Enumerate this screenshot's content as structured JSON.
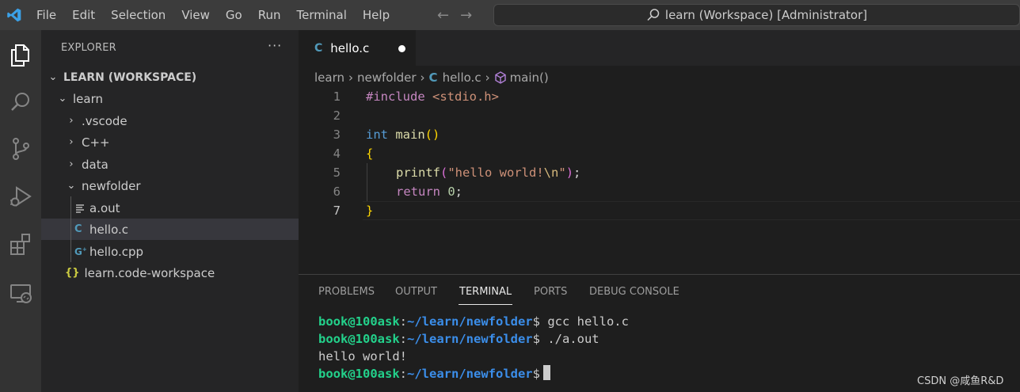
{
  "menu": [
    "File",
    "Edit",
    "Selection",
    "View",
    "Go",
    "Run",
    "Terminal",
    "Help"
  ],
  "search": {
    "text": "learn (Workspace) [Administrator]"
  },
  "sidebar": {
    "header": "EXPLORER",
    "more": "···",
    "tree": [
      {
        "label": "LEARN (WORKSPACE)",
        "icon": "chevron-down",
        "bold": true
      },
      {
        "label": "learn",
        "icon": "chevron-down"
      },
      {
        "label": ".vscode",
        "icon": "chevron-right"
      },
      {
        "label": "C++",
        "icon": "chevron-right"
      },
      {
        "label": "data",
        "icon": "chevron-right"
      },
      {
        "label": "newfolder",
        "icon": "chevron-down"
      },
      {
        "label": "a.out",
        "icon": "text-file-icon"
      },
      {
        "label": "hello.c",
        "icon": "c-file-icon",
        "selected": true
      },
      {
        "label": "hello.cpp",
        "icon": "cpp-file-icon"
      },
      {
        "label": "learn.code-workspace",
        "icon": "json-braces-icon"
      }
    ]
  },
  "editor": {
    "tab": {
      "name": "hello.c",
      "modified": true,
      "icon_text": "C"
    },
    "breadcrumbs": [
      "learn",
      "newfolder",
      "hello.c",
      "main()"
    ],
    "line_numbers": [
      "1",
      "2",
      "3",
      "4",
      "5",
      "6",
      "7"
    ],
    "active_line": "7",
    "code": {
      "l1_pre": "#include",
      "l1_hdr": " <stdio.h>",
      "l3_kw": "int",
      "l3_fn": " main",
      "l3_br": "()",
      "l4_br": "{",
      "l5_fn": "printf",
      "l5_open": "(",
      "l5_str1": "\"hello world!",
      "l5_esc": "\\n",
      "l5_str2": "\"",
      "l5_close": ")",
      "l5_semi": ";",
      "l6_kw": "return",
      "l6_num": " 0",
      "l6_semi": ";",
      "l7_br": "}"
    }
  },
  "panel": {
    "tabs": [
      "PROBLEMS",
      "OUTPUT",
      "TERMINAL",
      "PORTS",
      "DEBUG CONSOLE"
    ],
    "active_tab": "TERMINAL",
    "terminal": {
      "user": "book@100ask",
      "colon": ":",
      "path": "~/learn/newfolder",
      "dollar": "$",
      "cmd1": " gcc hello.c",
      "cmd2": " ./a.out",
      "output": "hello world!"
    }
  },
  "watermark": "CSDN @咸鱼R&D",
  "colors": {
    "accent": "#007acc",
    "c_icon": "#519aba",
    "terminal_user": "#23d18b",
    "terminal_path": "#3b8eea"
  }
}
